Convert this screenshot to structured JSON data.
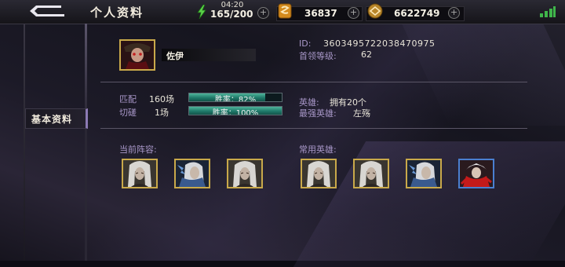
{
  "header": {
    "title": "个人资料",
    "timer": "04:20",
    "energy": "165/200",
    "gems": "36837",
    "gold": "6622749"
  },
  "sidebar": {
    "tabs": [
      {
        "label": "基本资料",
        "active": true
      }
    ]
  },
  "profile": {
    "name": "佐伊",
    "id_label": "ID:",
    "id_value": "3603495722038470975",
    "level_label": "首领等级:",
    "level_value": "62"
  },
  "stats": {
    "match": {
      "label": "匹配",
      "count": "160场",
      "win_rate_text": "胜率：82%",
      "win_rate": 82
    },
    "duel": {
      "label": "切磋",
      "count": "1场",
      "win_rate_text": "胜率：100%",
      "win_rate": 100
    },
    "heroes_label": "英雄:",
    "heroes_value": "拥有20个",
    "strongest_label": "最强英雄:",
    "strongest_value": "左殇"
  },
  "current_lineup": {
    "title": "当前阵容:",
    "heroes": [
      {
        "icon": "white-hair-hero-portrait",
        "frame": "gold"
      },
      {
        "icon": "blue-armor-hero-portrait",
        "frame": "gold"
      },
      {
        "icon": "white-hair-hero-portrait",
        "frame": "gold"
      }
    ]
  },
  "common_heroes": {
    "title": "常用英雄:",
    "heroes": [
      {
        "icon": "white-hair-hero-portrait",
        "frame": "gold"
      },
      {
        "icon": "white-hair-hero-portrait",
        "frame": "gold"
      },
      {
        "icon": "blue-armor-hero-portrait",
        "frame": "gold"
      },
      {
        "icon": "red-scarf-hero-portrait",
        "frame": "blue"
      }
    ]
  },
  "colors": {
    "accent_label": "#a897c8",
    "gold_frame": "#c9a94a",
    "blue_frame": "#4a7fd0",
    "rate_bar": "#1f7a6a"
  }
}
